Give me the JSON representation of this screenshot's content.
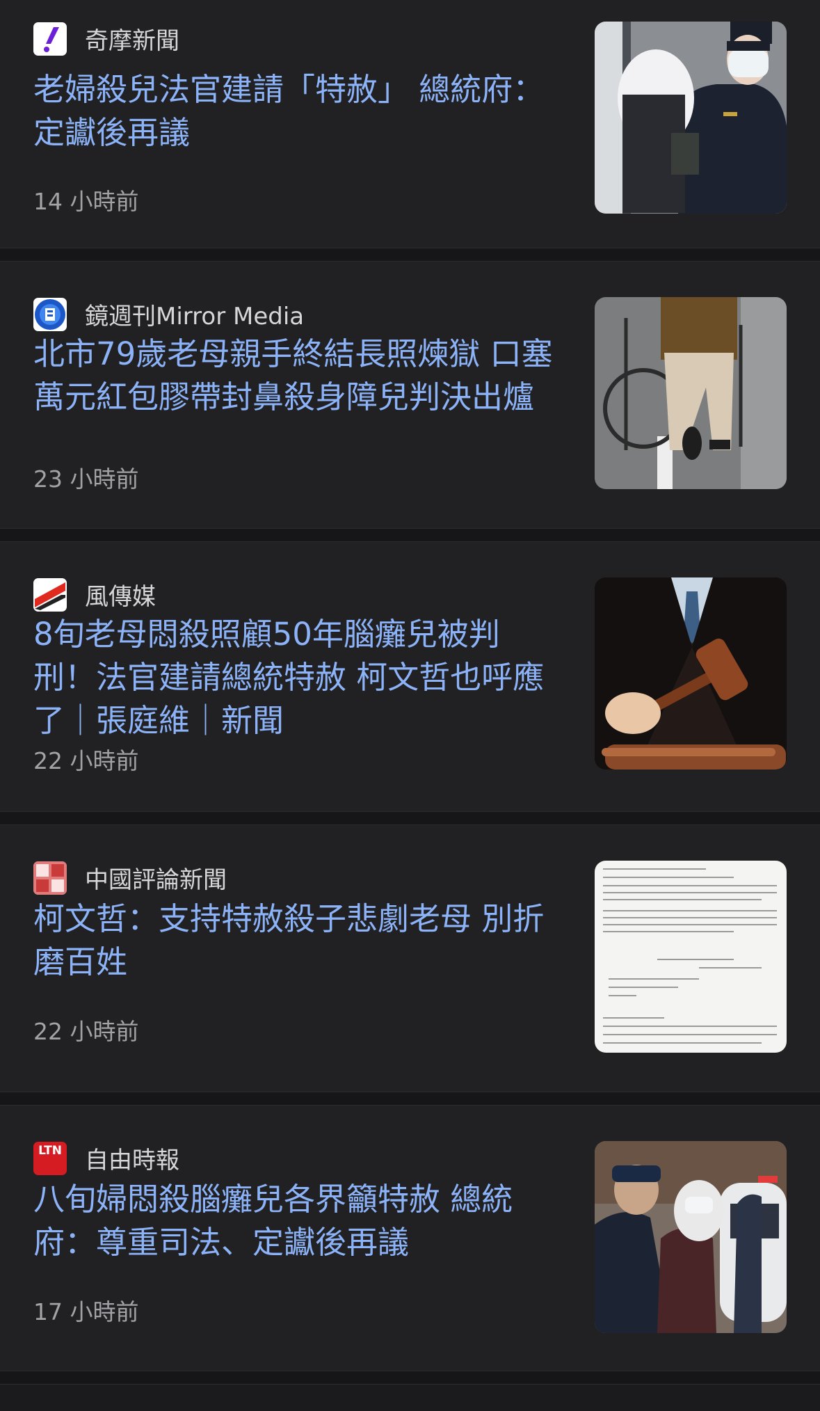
{
  "articles": [
    {
      "source": "奇摩新聞",
      "logo_icon": "yahoo-exclamation-icon",
      "title": "老婦殺兒法官建請「特赦」 總統府：定讞後再議",
      "time": "14 小時前",
      "thumbnail": "photo-masked-woman-escorted-by-police"
    },
    {
      "source": "鏡週刊Mirror Media",
      "logo_icon": "mirror-media-icon",
      "title": "北市79歲老母親手終結長照煉獄 口塞萬元紅包膠帶封鼻殺身障兒判決出爐",
      "time": "23 小時前",
      "thumbnail": "photo-person-with-wheelchair"
    },
    {
      "source": "風傳媒",
      "logo_icon": "storm-media-icon",
      "title": "8旬老母悶殺照顧50年腦癱兒被判刑！法官建請總統特赦 柯文哲也呼應了｜張庭維｜新聞",
      "time": "22 小時前",
      "thumbnail": "photo-judge-with-gavel"
    },
    {
      "source": "中國評論新聞",
      "logo_icon": "crntt-icon",
      "title": "柯文哲：支持特赦殺子悲劇老母 別折磨百姓",
      "time": "22 小時前",
      "thumbnail": "photo-printed-document"
    },
    {
      "source": "自由時報",
      "logo_icon": "ltn-icon",
      "logo_text": "LTN",
      "title": "八旬婦悶殺腦癱兒各界籲特赦 總統府：尊重司法、定讞後再議",
      "time": "17 小時前",
      "thumbnail": "photo-woman-escorted-to-police-car"
    }
  ],
  "colors": {
    "background": "#1b1b1d",
    "card": "#212124",
    "headline": "#8cb3f7",
    "source_text": "#d7d7da",
    "time_text": "#a3a3a7"
  }
}
